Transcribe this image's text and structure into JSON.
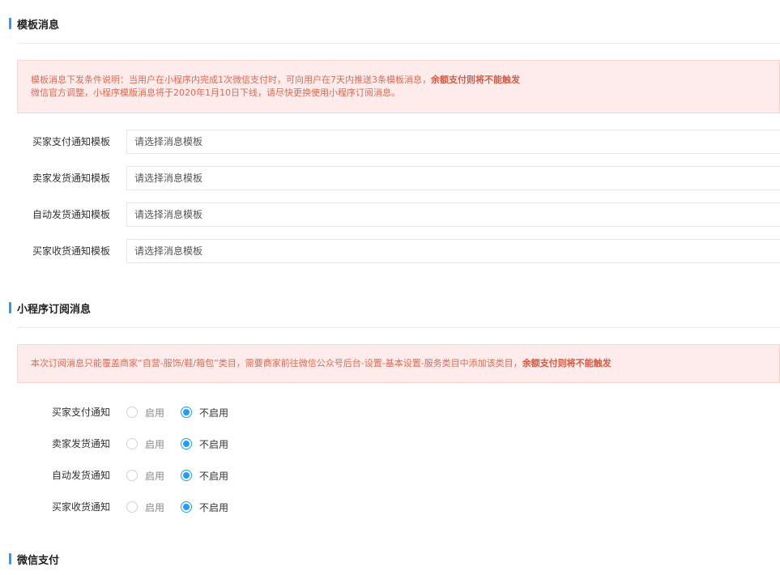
{
  "template_section": {
    "title": "模板消息",
    "notice_line1": "模板消息下发条件说明：当用户在小程序内完成1次微信支付时，可向用户在7天内推送3条模板消息，",
    "notice_line1_strong": "余额支付则将不能触发",
    "notice_line2": "微信官方调整，小程序模版消息将于2020年1月10日下线，请尽快更换使用小程序订阅消息。",
    "rows": [
      {
        "label": "买家支付通知模板",
        "placeholder": "请选择消息模板"
      },
      {
        "label": "卖家发货通知模板",
        "placeholder": "请选择消息模板"
      },
      {
        "label": "自动发货通知模板",
        "placeholder": "请选择消息模板"
      },
      {
        "label": "买家收货通知模板",
        "placeholder": "请选择消息模板"
      }
    ]
  },
  "subscribe_section": {
    "title": "小程序订阅消息",
    "notice": "本次订阅消息只能覆盖商家“自营-服饰/鞋/箱包”类目，需要商家前往微信公众号后台-设置-基本设置-服务类目中添加该类目，",
    "notice_strong": "余额支付则将不能触发",
    "option_on": "启用",
    "option_off": "不启用",
    "rows": [
      {
        "label": "买家支付通知",
        "selected": "不启用"
      },
      {
        "label": "卖家发货通知",
        "selected": "不启用"
      },
      {
        "label": "自动发货通知",
        "selected": "不启用"
      },
      {
        "label": "买家收货通知",
        "selected": "不启用"
      }
    ]
  },
  "wechat_section": {
    "title": "微信支付"
  },
  "colors": {
    "accent": "#1e9fff",
    "alert_bg": "#fdeceb",
    "alert_text": "#e06a53"
  }
}
